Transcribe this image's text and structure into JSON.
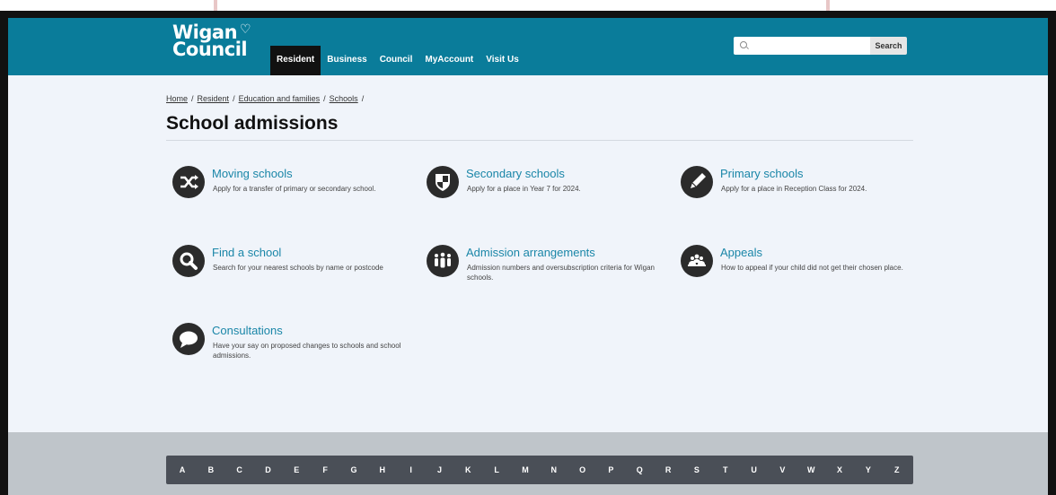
{
  "header": {
    "logo_line1": "Wigan",
    "logo_line2": "Council",
    "nav": [
      "Resident",
      "Business",
      "Council",
      "MyAccount",
      "Visit Us"
    ],
    "search_placeholder": "",
    "search_button": "Search"
  },
  "breadcrumb": {
    "items": [
      "Home",
      "Resident",
      "Education and families",
      "Schools"
    ],
    "separator": "/"
  },
  "page_title": "School admissions",
  "cards": [
    {
      "title": "Moving schools",
      "desc": "Apply for a transfer of primary or secondary school.",
      "icon": "shuffle-icon"
    },
    {
      "title": "Secondary schools",
      "desc": "Apply for a place in Year 7 for 2024.",
      "icon": "shield-icon"
    },
    {
      "title": "Primary schools",
      "desc": "Apply for a place in Reception Class for 2024.",
      "icon": "pencil-icon"
    },
    {
      "title": "Find a school",
      "desc": "Search for your nearest schools by name or postcode",
      "icon": "magnifier-icon"
    },
    {
      "title": "Admission arrangements",
      "desc": "Admission numbers and oversubscription criteria for Wigan schools.",
      "icon": "people-icon"
    },
    {
      "title": "Appeals",
      "desc": "How to appeal if your child did not get their chosen place.",
      "icon": "group-icon"
    },
    {
      "title": "Consultations",
      "desc": "Have your say on proposed changes to schools and school admissions.",
      "icon": "speech-bubble-icon"
    }
  ],
  "alphabet": [
    "A",
    "B",
    "C",
    "D",
    "E",
    "F",
    "G",
    "H",
    "I",
    "J",
    "K",
    "L",
    "M",
    "N",
    "O",
    "P",
    "Q",
    "R",
    "S",
    "T",
    "U",
    "V",
    "W",
    "X",
    "Y",
    "Z"
  ],
  "colors": {
    "header": "#0a7c9a",
    "link": "#1a86a8",
    "nav_active": "#111111",
    "footer": "#bfc5ca",
    "alpha_bar": "#4a4f57"
  }
}
